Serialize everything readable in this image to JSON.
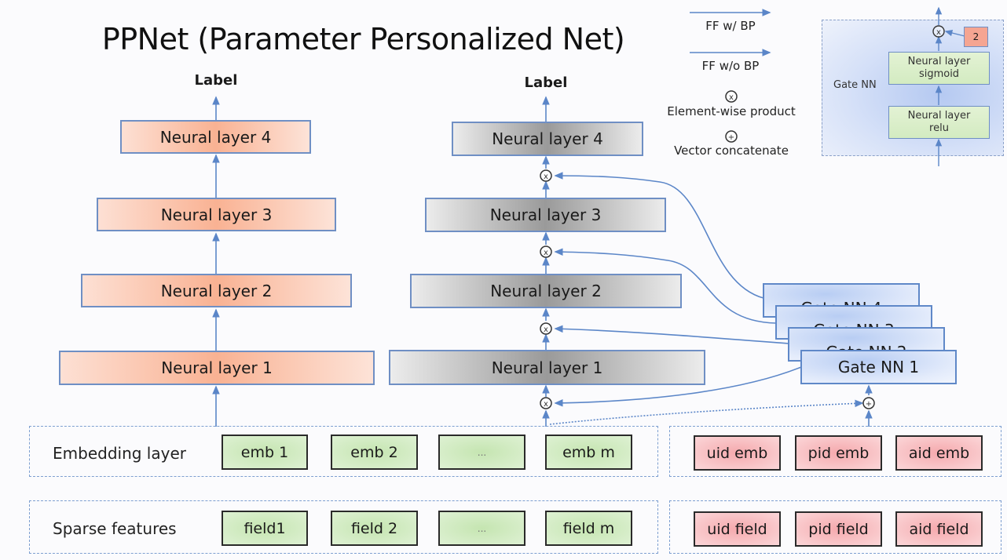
{
  "title": "PPNet (Parameter Personalized Net)",
  "left_tower": {
    "label": "Label",
    "layers": [
      "Neural layer 4",
      "Neural layer 3",
      "Neural layer 2",
      "Neural layer 1"
    ]
  },
  "ppnet_tower": {
    "label": "Label",
    "layers": [
      "Neural layer 4",
      "Neural layer 3",
      "Neural layer 2",
      "Neural layer 1"
    ]
  },
  "gate_nns": [
    "Gate NN 4",
    "Gate NN 3",
    "Gate NN 2",
    "Gate NN 1"
  ],
  "legend": {
    "ff_with_bp": "FF w/ BP",
    "ff_without_bp": "FF w/o BP",
    "product_symbol": "x",
    "product_label": "Element-wise product",
    "concat_symbol": "+",
    "concat_label": "Vector concatenate"
  },
  "gate_detail": {
    "label": "Gate NN",
    "layer_top": [
      "Neural layer",
      "sigmoid"
    ],
    "layer_bottom": [
      "Neural layer",
      "relu"
    ],
    "scale": "2",
    "product_symbol": "x"
  },
  "embedding_row": {
    "label": "Embedding layer",
    "items": [
      "emb 1",
      "emb 2",
      "...",
      "emb m"
    ],
    "personal_items": [
      "uid emb",
      "pid emb",
      "aid emb"
    ]
  },
  "sparse_row": {
    "label": "Sparse features",
    "items": [
      "field1",
      "field 2",
      "...",
      "field m"
    ],
    "personal_items": [
      "uid field",
      "pid field",
      "aid field"
    ]
  },
  "colors": {
    "arrow": "#5b86c8",
    "orange_layer": "#f9b293",
    "gray_layer": "#9a9a9a",
    "gate_layer": "#b8cdf3",
    "green_box": "#c5e5b1",
    "pink_box": "#f5a9ad"
  }
}
